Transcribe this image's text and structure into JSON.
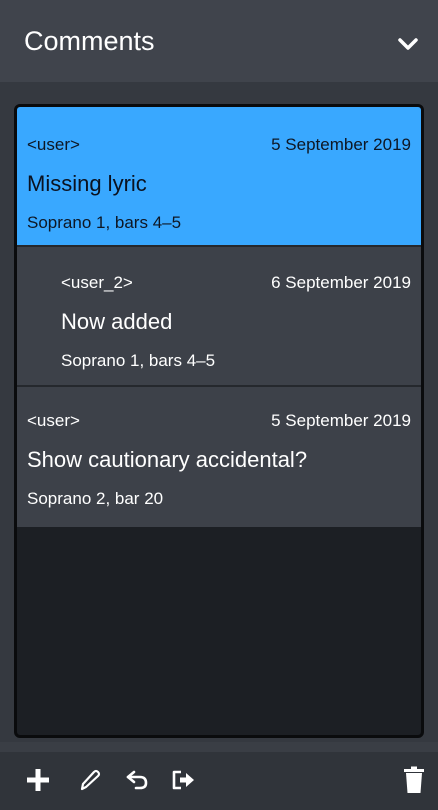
{
  "panel": {
    "title": "Comments",
    "collapse_icon": "chevron-down-icon"
  },
  "comments": [
    {
      "user": "<user>",
      "date": "5 September 2019",
      "text": "Missing lyric",
      "location": "Soprano 1, bars 4–5",
      "selected": true,
      "reply": false
    },
    {
      "user": "<user_2>",
      "date": "6 September 2019",
      "text": "Now added",
      "location": "Soprano 1, bars 4–5",
      "selected": false,
      "reply": true
    },
    {
      "user": "<user>",
      "date": "5 September 2019",
      "text": "Show cautionary accidental?",
      "location": "Soprano 2, bar 20",
      "selected": false,
      "reply": false
    }
  ],
  "toolbar": {
    "buttons": [
      "plus-icon",
      "pencil-icon",
      "reply-icon",
      "export-icon",
      "trash-icon"
    ]
  },
  "colors": {
    "selected_bg": "#39a8ff",
    "item_bg": "#3d4149",
    "list_bg": "#1c1f24"
  }
}
